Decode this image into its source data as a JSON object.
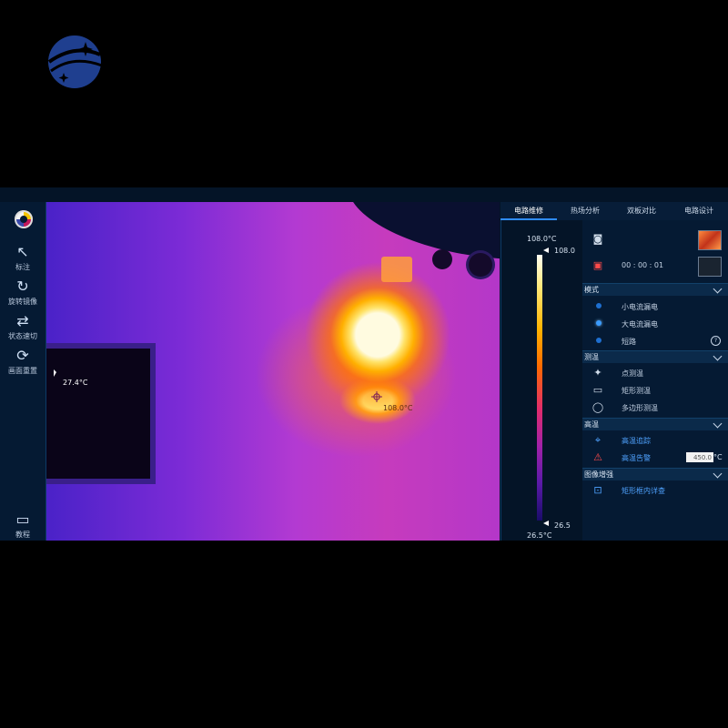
{
  "toolbar": {
    "items": [
      {
        "icon": "cursor-arrow-icon",
        "label": "标注"
      },
      {
        "icon": "rotate-mirror-icon",
        "label": "旋转镜像"
      },
      {
        "icon": "swap-arrows-icon",
        "label": "状态速切"
      },
      {
        "icon": "refresh-icon",
        "label": "画面重置"
      },
      {
        "icon": "book-icon",
        "label": "教程"
      }
    ]
  },
  "thermal": {
    "cold_spot_label": "27.4°C",
    "hot_spot_label": "108.0°C"
  },
  "scale": {
    "max_label": "108.0°C",
    "max_value": "108.0",
    "min_value": "26.5",
    "min_label": "26.5°C"
  },
  "tabs": [
    {
      "label": "电路维修",
      "active": true
    },
    {
      "label": "热场分析",
      "active": false
    },
    {
      "label": "双板对比",
      "active": false
    },
    {
      "label": "电路设计",
      "active": false
    }
  ],
  "record": {
    "timer": "00 : 00 : 01"
  },
  "sections": {
    "mode": {
      "title": "模式",
      "items": [
        "小电流漏电",
        "大电流漏电",
        "短路"
      ],
      "selected_index": 1
    },
    "measure": {
      "title": "测温",
      "items": [
        "点测温",
        "矩形测温",
        "多边形测温"
      ]
    },
    "high_temp": {
      "title": "高温",
      "track_label": "高温追踪",
      "alarm_label": "高温告警",
      "alarm_value": "450.0",
      "alarm_unit": "°C"
    },
    "enhance": {
      "title": "图像增强",
      "item": "矩形框内详查"
    }
  },
  "colors": {
    "accent": "#2f8cff",
    "panel_bg": "#051a33",
    "section_bg": "#0b2a4a"
  }
}
